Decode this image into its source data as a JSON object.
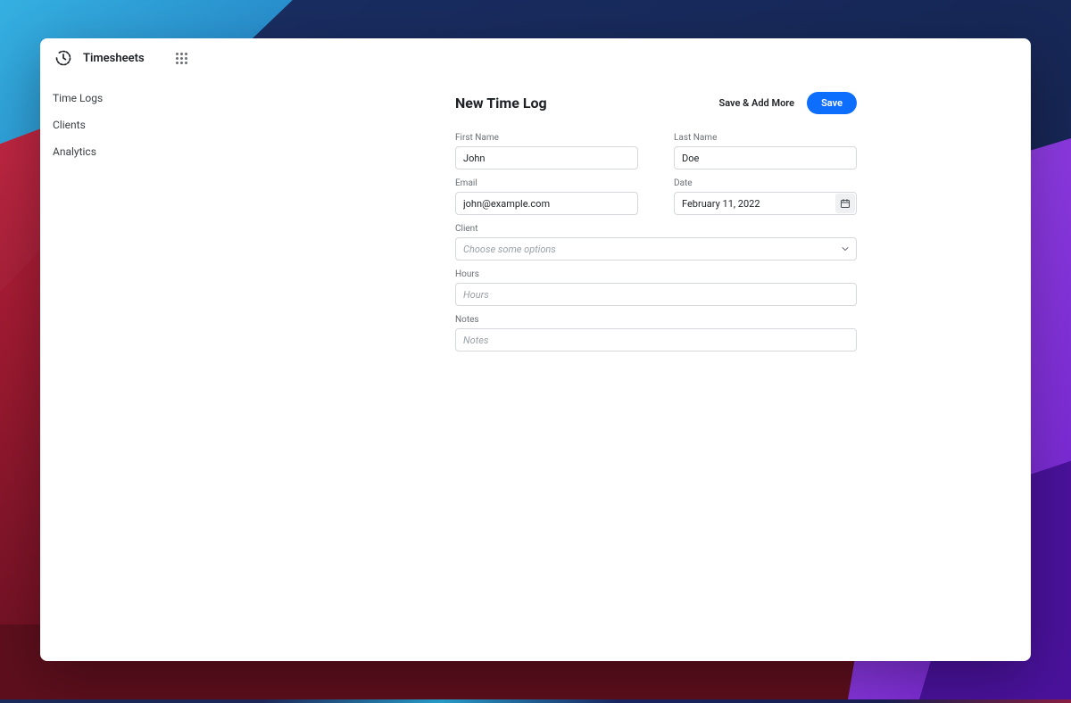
{
  "app": {
    "title": "Timesheets"
  },
  "sidebar": {
    "items": [
      {
        "label": "Time Logs"
      },
      {
        "label": "Clients"
      },
      {
        "label": "Analytics"
      }
    ]
  },
  "page": {
    "title": "New Time Log",
    "buttons": {
      "save_add_more": "Save & Add More",
      "save": "Save"
    }
  },
  "form": {
    "first_name": {
      "label": "First Name",
      "value": "John"
    },
    "last_name": {
      "label": "Last Name",
      "value": "Doe"
    },
    "email": {
      "label": "Email",
      "value": "john@example.com"
    },
    "date": {
      "label": "Date",
      "value": "February 11, 2022"
    },
    "client": {
      "label": "Client",
      "placeholder": "Choose some options"
    },
    "hours": {
      "label": "Hours",
      "placeholder": "Hours"
    },
    "notes": {
      "label": "Notes",
      "placeholder": "Notes"
    }
  }
}
